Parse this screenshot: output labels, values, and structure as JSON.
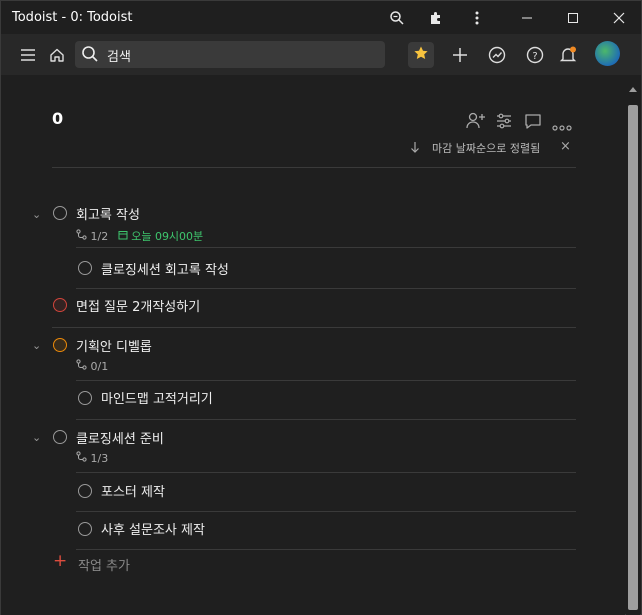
{
  "window": {
    "title": "Todoist - 0: Todoist"
  },
  "toolbar": {
    "search_label": "검색"
  },
  "project": {
    "title": "0"
  },
  "sort": {
    "label": "마감 날짜순으로 정렬됨",
    "close": "×"
  },
  "tasks": [
    {
      "name": "회고록 작성",
      "subtasks": "1/2",
      "due": "오늘 09시00분"
    },
    {
      "name": "클로징세션 회고록 작성"
    },
    {
      "name": "면접 질문 2개작성하기"
    },
    {
      "name": "기획안 디벨롭",
      "subtasks": "0/1"
    },
    {
      "name": "마인드맵 고적거리기"
    },
    {
      "name": "클로징세션 준비",
      "subtasks": "1/3"
    },
    {
      "name": "포스터 제작"
    },
    {
      "name": "사후 설문조사 제작"
    }
  ],
  "add_task": {
    "label": "작업 추가"
  },
  "colors": {
    "accent": "#dc4c3e",
    "due": "#3ec56d",
    "priority1": "#d1453b",
    "priority2": "#eb8909",
    "star": "#f7c33f"
  }
}
